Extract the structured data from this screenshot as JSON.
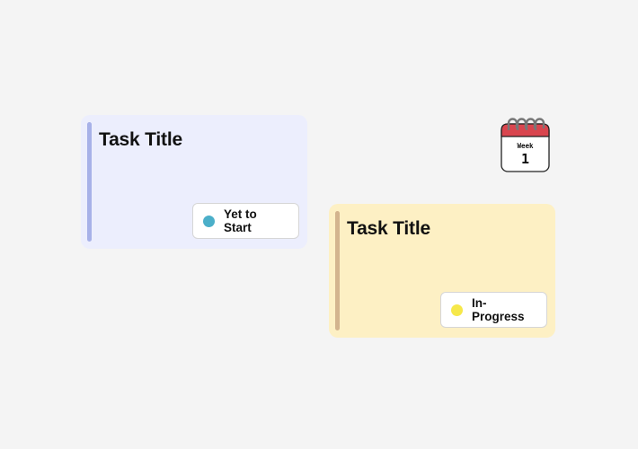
{
  "colors": {
    "background": "#f4f4f4",
    "card1_bg": "#eceefd",
    "card1_accent": "#a7b1e8",
    "card2_bg": "#fdf0c4",
    "card2_accent": "#d3b48e",
    "status_yet_to_start": "#4bafc9",
    "status_in_progress": "#f6e84a",
    "calendar_header": "#d9454e"
  },
  "cards": [
    {
      "title": "Task Title",
      "status": "Yet to Start"
    },
    {
      "title": "Task Title",
      "status": "In-Progress"
    }
  ],
  "calendar": {
    "label": "Week",
    "number": "1",
    "icon": "calendar-icon"
  }
}
